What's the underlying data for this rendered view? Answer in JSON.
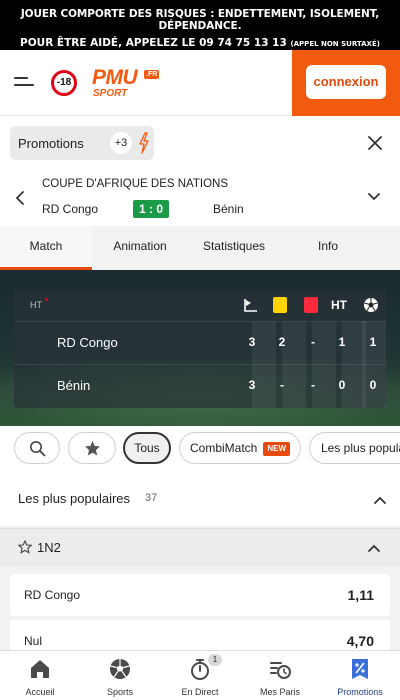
{
  "warning": {
    "line1": "JOUER COMPORTE DES RISQUES : ENDETTEMENT, ISOLEMENT, DÉPENDANCE.",
    "line2": "POUR ÊTRE AIDÉ, APPELEZ LE 09 74 75 13 13",
    "line2_small": "(APPEL NON SURTAXÉ)"
  },
  "header": {
    "age_limit": "-18",
    "logo_text": "PMU",
    "logo_fr": ".FR",
    "logo_sport": "SPORT",
    "login_label": "connexion",
    "brand_color": "#f25a0f"
  },
  "promo": {
    "label": "Promotions",
    "count": "+3"
  },
  "match": {
    "competition": "COUPE D'AFRIQUE DES NATIONS",
    "home": "RD Congo",
    "score": "1 : 0",
    "away": "Bénin"
  },
  "tabs": [
    {
      "label": "Match",
      "active": true
    },
    {
      "label": "Animation"
    },
    {
      "label": "Statistiques"
    },
    {
      "label": "Info"
    }
  ],
  "scoreboard": {
    "period": "HT",
    "ht_label": "HT",
    "columns": [
      "corner-flag-icon",
      "yellow-card-icon",
      "red-card-icon",
      "HT",
      "ball-icon"
    ],
    "rows": [
      {
        "team": "RD Congo",
        "corners": "3",
        "yellow": "2",
        "red": "-",
        "ht": "1",
        "goals": "1"
      },
      {
        "team": "Bénin",
        "corners": "3",
        "yellow": "-",
        "red": "-",
        "ht": "0",
        "goals": "0"
      }
    ]
  },
  "filters": {
    "all": "Tous",
    "combi": "CombiMatch",
    "new_badge": "NEW",
    "popular": "Les plus populaires"
  },
  "popular_section": {
    "label": "Les plus populaires",
    "count": "37"
  },
  "market": {
    "label": "1N2",
    "odds": [
      {
        "name": "RD Congo",
        "value": "1,11"
      },
      {
        "name": "Nul",
        "value": "4,70"
      }
    ]
  },
  "bottom_nav": [
    {
      "label": "Accueil",
      "icon": "home-icon"
    },
    {
      "label": "Sports",
      "icon": "football-icon"
    },
    {
      "label": "En Direct",
      "icon": "stopwatch-icon",
      "badge": "1"
    },
    {
      "label": "Mes Paris",
      "icon": "history-icon"
    },
    {
      "label": "Promotions",
      "icon": "promo-tag-icon",
      "active": true
    }
  ]
}
